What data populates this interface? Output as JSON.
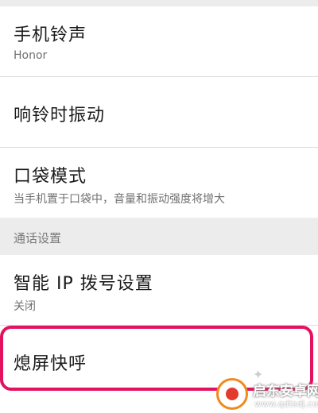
{
  "settings": {
    "ringtone": {
      "title": "手机铃声",
      "value": "Honor"
    },
    "vibrate_on_ring": {
      "title": "响铃时振动"
    },
    "pocket_mode": {
      "title": "口袋模式",
      "description": "当手机置于口袋中，音量和振动强度将增大"
    },
    "section_call_settings": "通话设置",
    "ip_dial": {
      "title": "智能 IP 拨号设置",
      "value": "关闭"
    },
    "screen_off_quick_call": {
      "title": "熄屏快呼"
    }
  },
  "watermark": {
    "title": "启东安卓网",
    "url": "www.qdtsdj.com",
    "logo_icon": "orange-red-circle-logo-icon"
  },
  "colors": {
    "highlight_border": "#e3125f",
    "background": "#f2f2f2",
    "row_background": "#ffffff"
  }
}
